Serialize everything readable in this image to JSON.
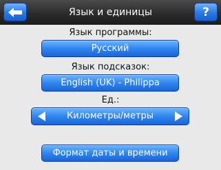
{
  "header": {
    "title": "Язык и единицы",
    "back_icon": "back-arrow-icon",
    "help_label": "?"
  },
  "settings": {
    "program_language_label": "Язык программы:",
    "program_language_value": "Русский",
    "voice_language_label": "Язык подсказок:",
    "voice_language_value": "English (UK) - Philippa",
    "units_label": "Ед.:",
    "units_value": "Километры/метры",
    "date_time_button": "Формат даты и времени"
  },
  "colors": {
    "accent": "#2f86ee",
    "header_bg": "#2c2c2c",
    "background": "#e9e9e9"
  }
}
